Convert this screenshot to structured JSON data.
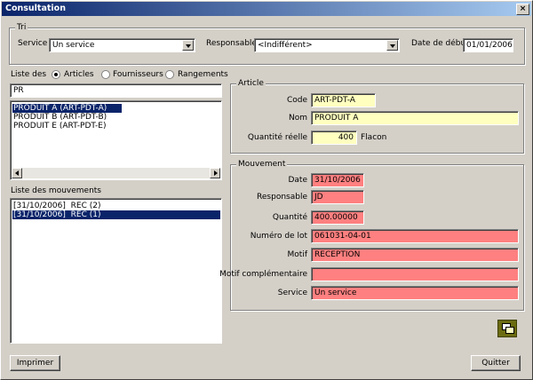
{
  "window": {
    "title": "Consultation",
    "close": "×"
  },
  "tri": {
    "title": "Tri",
    "service_label": "Service",
    "service_value": "Un service",
    "responsable_label": "Responsable",
    "responsable_value": "<Indifférent>",
    "date_label": "Date de début",
    "date_value": "01/01/2006"
  },
  "liste": {
    "label": "Liste des",
    "radios": [
      "Articles",
      "Fournisseurs",
      "Rangements"
    ],
    "selected_radio": "Articles",
    "filter_value": "PR",
    "items": [
      "PRODUIT A (ART-PDT-A)",
      "PRODUIT B (ART-PDT-B)",
      "PRODUIT E (ART-PDT-E)"
    ],
    "selected_item": 0
  },
  "mouvements": {
    "label": "Liste des mouvements",
    "items": [
      {
        "date": "[31/10/2006]",
        "text": "REC (2)"
      },
      {
        "date": "[31/10/2006]",
        "text": "REC (1)"
      }
    ],
    "selected_item": 1
  },
  "article": {
    "title": "Article",
    "code_label": "Code",
    "code_value": "ART-PDT-A",
    "nom_label": "Nom",
    "nom_value": "PRODUIT A",
    "qte_label": "Quantité réelle",
    "qte_value": "400",
    "unit": "Flacon"
  },
  "mouvement": {
    "title": "Mouvement",
    "date_label": "Date",
    "date_value": "31/10/2006",
    "resp_label": "Responsable",
    "resp_value": "JD",
    "qte_label": "Quantité",
    "qte_value": "400.00000",
    "lot_label": "Numéro de lot",
    "lot_value": "061031-04-01",
    "motif_label": "Motif",
    "motif_value": "RECEPTION",
    "motifc_label": "Motif complémentaire",
    "motifc_value": "",
    "service_label": "Service",
    "service_value": "Un service"
  },
  "buttons": {
    "imprimer": "Imprimer",
    "quitter": "Quitter"
  },
  "colors": {
    "selection": "#0a246a",
    "yellow_field": "#ffffc0",
    "pink_field": "#ff8080"
  },
  "icons": {
    "close": "close-icon",
    "export": "window-export-icon"
  }
}
